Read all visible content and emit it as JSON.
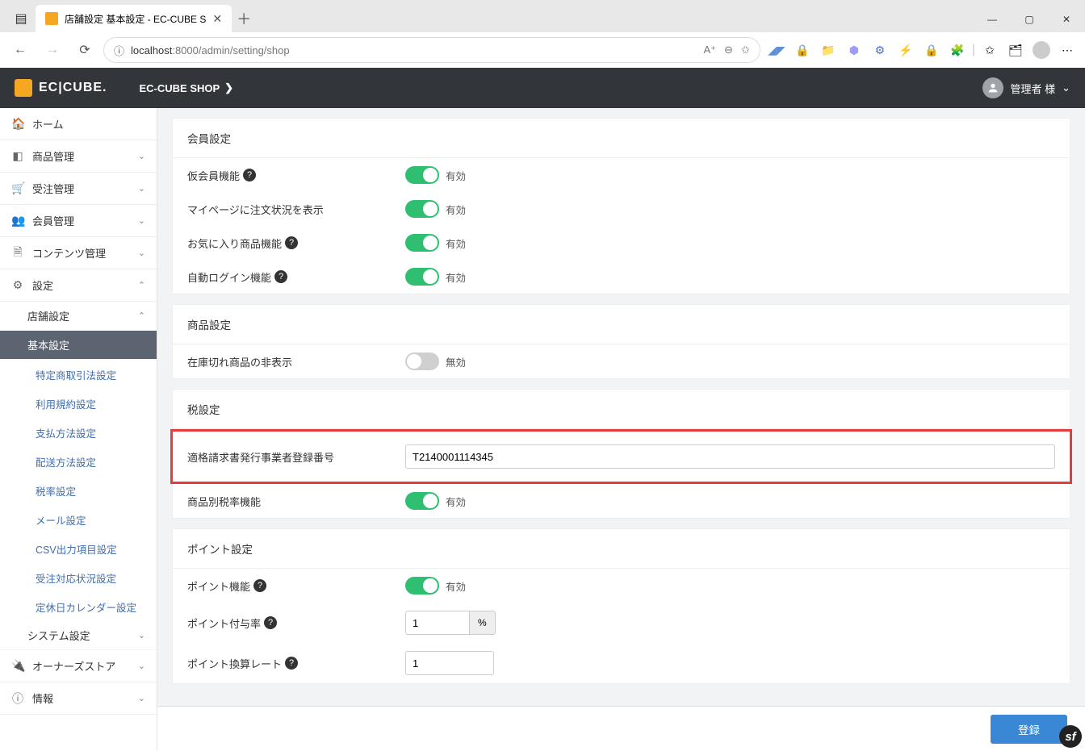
{
  "browser": {
    "tab_title": "店舗設定 基本設定 - EC-CUBE S",
    "url_host": "localhost",
    "url_path": ":8000/admin/setting/shop"
  },
  "header": {
    "logo_text": "EC|CUBE.",
    "shop_link": "EC-CUBE SHOP",
    "user_label": "管理者 様"
  },
  "sidebar": {
    "home": "ホーム",
    "products": "商品管理",
    "orders": "受注管理",
    "members": "会員管理",
    "contents": "コンテンツ管理",
    "settings": "設定",
    "shop_settings": "店舗設定",
    "sub": {
      "basic": "基本設定",
      "law": "特定商取引法設定",
      "terms": "利用規約設定",
      "payment": "支払方法設定",
      "delivery": "配送方法設定",
      "tax": "税率設定",
      "mail": "メール設定",
      "csv": "CSV出力項目設定",
      "ordercond": "受注対応状況設定",
      "holiday": "定休日カレンダー設定"
    },
    "system": "システム設定",
    "owners": "オーナーズストア",
    "info": "情報"
  },
  "sections": {
    "member": {
      "title": "会員設定",
      "provisional": "仮会員機能",
      "mypage_order": "マイページに注文状況を表示",
      "favorite": "お気に入り商品機能",
      "autologin": "自動ログイン機能"
    },
    "product": {
      "title": "商品設定",
      "hide_outofstock": "在庫切れ商品の非表示"
    },
    "tax": {
      "title": "税設定",
      "invoice_label": "適格請求書発行事業者登録番号",
      "invoice_value": "T2140001114345",
      "per_product": "商品別税率機能"
    },
    "point": {
      "title": "ポイント設定",
      "enable": "ポイント機能",
      "grant_rate": "ポイント付与率",
      "grant_rate_value": "1",
      "grant_rate_suffix": "%",
      "conv_rate": "ポイント換算レート",
      "conv_rate_value": "1"
    }
  },
  "labels": {
    "enabled": "有効",
    "disabled": "無効",
    "submit": "登録"
  }
}
